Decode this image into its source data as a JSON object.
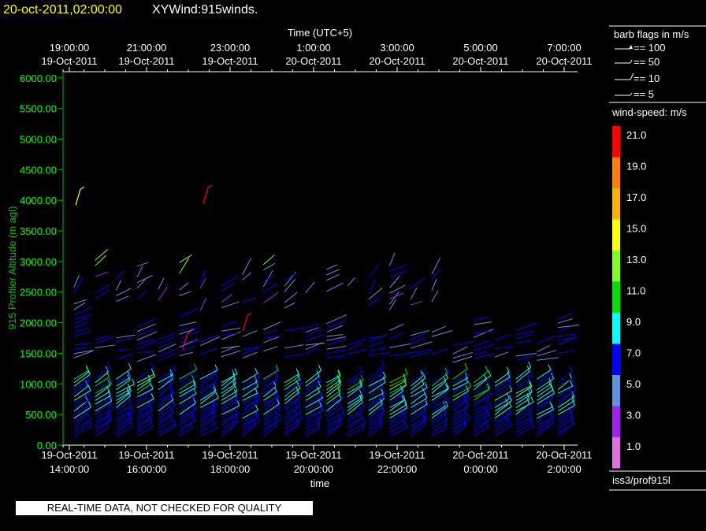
{
  "header": {
    "datetime": "20-oct-2011,02:00:00",
    "product": "XYWind:915winds."
  },
  "chart_data": {
    "type": "wind-barb-time-height",
    "ylabel": "915 Profiler Altitude (m agl)",
    "xlabel": "time",
    "top_axis_label": "Time (UTC+5)",
    "ylim": [
      0,
      6100
    ],
    "yticks": [
      "0.00",
      "500.00",
      "1000.00",
      "1500.00",
      "2000.00",
      "2500.00",
      "3000.00",
      "3500.00",
      "4000.00",
      "4500.00",
      "5000.00",
      "5500.00",
      "6000.00"
    ],
    "bottom_ticks": [
      {
        "date": "19-Oct-2011",
        "time": "14:00:00"
      },
      {
        "date": "19-Oct-2011",
        "time": "16:00:00"
      },
      {
        "date": "19-Oct-2011",
        "time": "18:00:00"
      },
      {
        "date": "19-Oct-2011",
        "time": "20:00:00"
      },
      {
        "date": "19-Oct-2011",
        "time": "22:00:00"
      },
      {
        "date": "20-Oct-2011",
        "time": "0:00:00"
      },
      {
        "date": "20-Oct-2011",
        "time": "2:00:00"
      }
    ],
    "top_ticks": [
      {
        "time": "19:00:00",
        "date": "19-Oct-2011"
      },
      {
        "time": "21:00:00",
        "date": "19-Oct-2011"
      },
      {
        "time": "23:00:00",
        "date": "19-Oct-2011"
      },
      {
        "time": "1:00:00",
        "date": "20-Oct-2011"
      },
      {
        "time": "3:00:00",
        "date": "20-Oct-2011"
      },
      {
        "time": "5:00:00",
        "date": "20-Oct-2011"
      },
      {
        "time": "7:00:00",
        "date": "20-Oct-2011"
      }
    ],
    "barb_legend_title": "barb flags in m/s",
    "barb_legend": [
      "== 100",
      "== 50",
      "== 10",
      "== 5"
    ],
    "speed_legend_title": "wind-speed: m/s",
    "speed_scale": [
      {
        "value": "21.0",
        "color": "#ff0000"
      },
      {
        "value": "19.0",
        "color": "#ff8000"
      },
      {
        "value": "17.0",
        "color": "#ffb000"
      },
      {
        "value": "15.0",
        "color": "#ffff00"
      },
      {
        "value": "13.0",
        "color": "#80ff20"
      },
      {
        "value": "11.0",
        "color": "#00e000"
      },
      {
        "value": "9.0",
        "color": "#00ffff"
      },
      {
        "value": "7.0",
        "color": "#0000ff"
      },
      {
        "value": "5.0",
        "color": "#6090e0"
      },
      {
        "value": "3.0",
        "color": "#a020f0"
      },
      {
        "value": "1.0",
        "color": "#e070e0"
      }
    ],
    "colors": {
      "axis": "#00c000",
      "grid_text": "#00ff00",
      "background": "#000000"
    }
  },
  "station": "iss3/prof915l",
  "quality_notice": "REAL-TIME DATA, NOT CHECKED FOR QUALITY"
}
